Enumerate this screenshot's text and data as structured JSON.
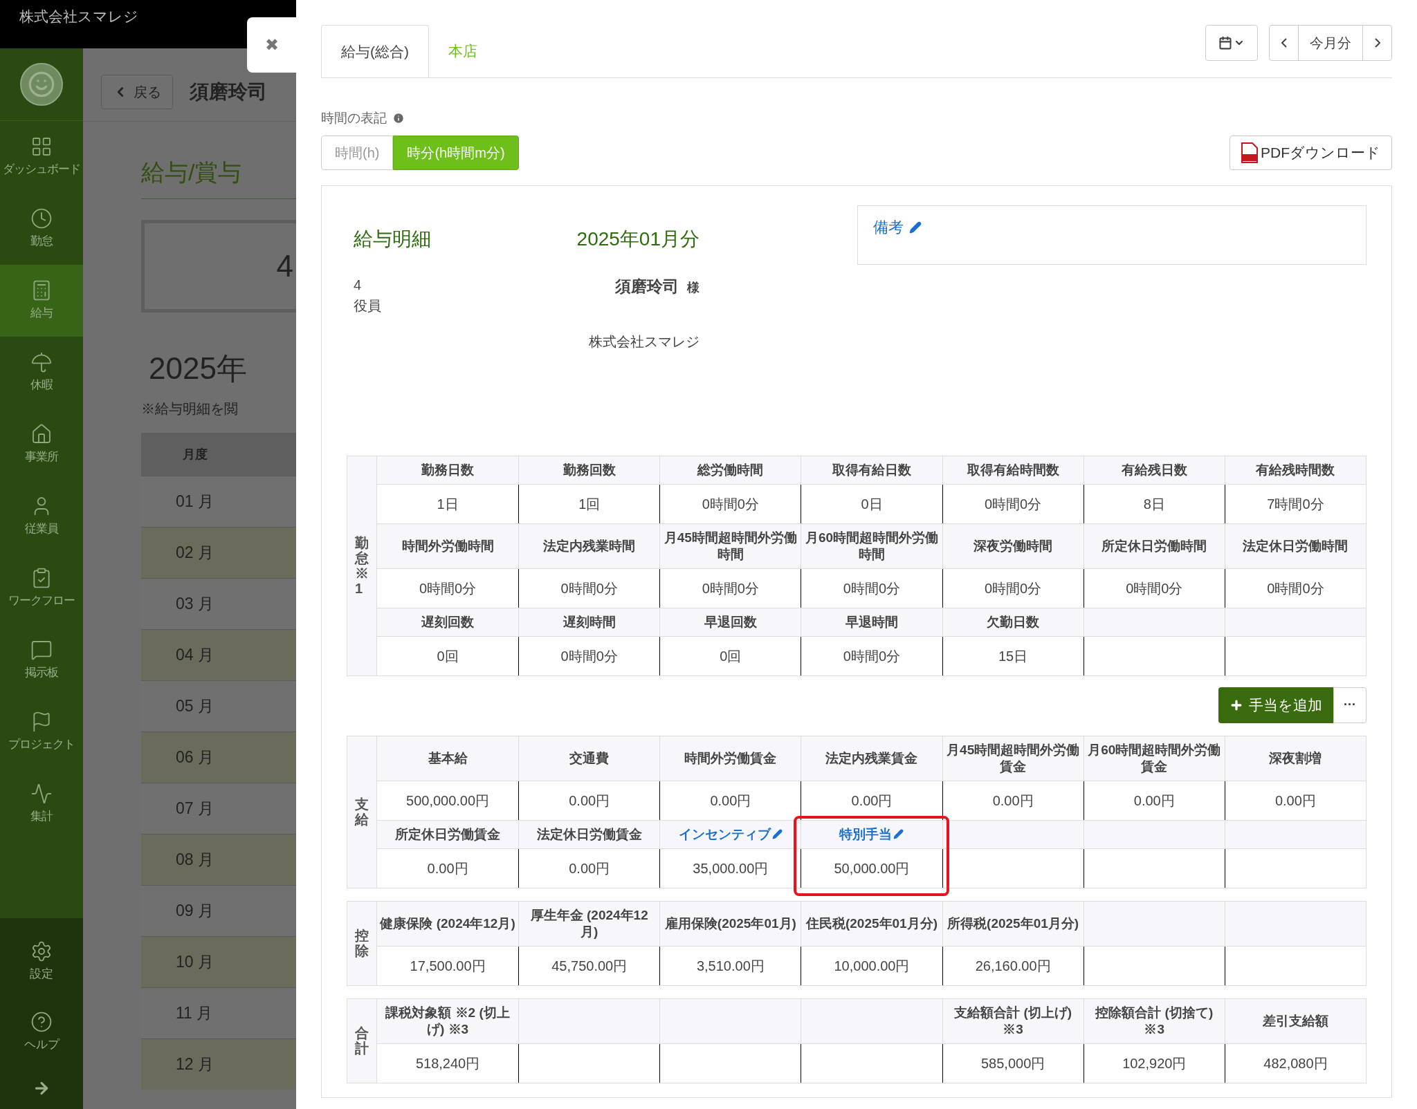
{
  "company": "株式会社スマレジ",
  "sidebar": {
    "items": [
      {
        "label": "ダッシュボード",
        "selected": false
      },
      {
        "label": "勤怠",
        "selected": false
      },
      {
        "label": "給与",
        "selected": true
      },
      {
        "label": "休暇",
        "selected": false
      },
      {
        "label": "事業所",
        "selected": false
      },
      {
        "label": "従業員",
        "selected": false
      },
      {
        "label": "ワークフロー",
        "selected": false
      },
      {
        "label": "掲示板",
        "selected": false
      },
      {
        "label": "プロジェクト",
        "selected": false
      },
      {
        "label": "集計",
        "selected": false
      }
    ],
    "bottom_items": [
      {
        "label": "設定"
      },
      {
        "label": "ヘルプ"
      }
    ]
  },
  "background": {
    "back_button": "戻る",
    "employee_name": "須磨玲司",
    "title": "給与/賞与",
    "card_text": "4",
    "year": "2025年",
    "note": "※給与明細を閲",
    "table_header": "月度",
    "months": [
      "01 月",
      "02 月",
      "03 月",
      "04 月",
      "05 月",
      "06 月",
      "07 月",
      "08 月",
      "09 月",
      "10 月",
      "11 月",
      "12 月"
    ]
  },
  "modal": {
    "close": "✖",
    "tabs": [
      {
        "label": "給与(総合)",
        "selected": true
      },
      {
        "label": "本店",
        "selected": false
      }
    ],
    "period": "今月分",
    "time_format": {
      "label": "時間の表記",
      "options": [
        {
          "label": "時間(h)",
          "selected": false
        },
        {
          "label": "時分(h時間m分)",
          "selected": true
        }
      ]
    },
    "pdf_button": "PDFダウンロード",
    "payslip": {
      "title": "給与明細",
      "month": "2025年01月分",
      "employee_number": "4",
      "position": "役員",
      "employee_name": "須磨玲司",
      "honorific": "様",
      "company": "株式会社スマレジ",
      "remarks": "備考"
    },
    "add_allowance_button": "手当を追加",
    "more_button": "···",
    "sections": [
      {
        "label": "勤怠※1",
        "rows": [
          {
            "cells": [
              {
                "header": "勤務日数",
                "value": "1日"
              },
              {
                "header": "勤務回数",
                "value": "1回"
              },
              {
                "header": "総労働時間",
                "value": "0時間0分"
              },
              {
                "header": "取得有給日数",
                "value": "0日"
              },
              {
                "header": "取得有給時間数",
                "value": "0時間0分"
              },
              {
                "header": "有給残日数",
                "value": "8日"
              },
              {
                "header": "有給残時間数",
                "value": "7時間0分"
              }
            ]
          },
          {
            "cells": [
              {
                "header": "時間外労働時間",
                "value": "0時間0分"
              },
              {
                "header": "法定内残業時間",
                "value": "0時間0分"
              },
              {
                "header": "月45時間超時間外労働時間",
                "value": "0時間0分"
              },
              {
                "header": "月60時間超時間外労働時間",
                "value": "0時間0分"
              },
              {
                "header": "深夜労働時間",
                "value": "0時間0分"
              },
              {
                "header": "所定休日労働時間",
                "value": "0時間0分"
              },
              {
                "header": "法定休日労働時間",
                "value": "0時間0分"
              }
            ]
          },
          {
            "cells": [
              {
                "header": "遅刻回数",
                "value": "0回"
              },
              {
                "header": "遅刻時間",
                "value": "0時間0分"
              },
              {
                "header": "早退回数",
                "value": "0回"
              },
              {
                "header": "早退時間",
                "value": "0時間0分"
              },
              {
                "header": "欠勤日数",
                "value": "15日"
              },
              {},
              {}
            ]
          }
        ]
      },
      {
        "label": "支給",
        "rows": [
          {
            "cells": [
              {
                "header": "基本給",
                "value": "500,000.00円"
              },
              {
                "header": "交通費",
                "value": "0.00円"
              },
              {
                "header": "時間外労働賃金",
                "value": "0.00円"
              },
              {
                "header": "法定内残業賃金",
                "value": "0.00円"
              },
              {
                "header": "月45時間超時間外労働賃金",
                "value": "0.00円"
              },
              {
                "header": "月60時間超時間外労働賃金",
                "value": "0.00円"
              },
              {
                "header": "深夜割増",
                "value": "0.00円"
              }
            ]
          },
          {
            "cells": [
              {
                "header": "所定休日労働賃金",
                "value": "0.00円"
              },
              {
                "header": "法定休日労働賃金",
                "value": "0.00円"
              },
              {
                "header": "インセンティブ",
                "value": "35,000.00円",
                "kind": "editable"
              },
              {
                "header": "特別手当",
                "value": "50,000.00円",
                "kind": "editable",
                "highlighted": true
              },
              {},
              {},
              {}
            ]
          }
        ]
      },
      {
        "label": "控除",
        "rows": [
          {
            "cells": [
              {
                "header": "健康保険 (2024年12月)",
                "value": "17,500.00円"
              },
              {
                "header": "厚生年金 (2024年12月)",
                "value": "45,750.00円"
              },
              {
                "header": "雇用保険(2025年01月)",
                "value": "3,510.00円"
              },
              {
                "header": "住民税(2025年01月分)",
                "value": "10,000.00円"
              },
              {
                "header": "所得税(2025年01月分)",
                "value": "26,160.00円"
              },
              {},
              {}
            ]
          }
        ]
      },
      {
        "label": "合計",
        "rows": [
          {
            "cells": [
              {
                "header": "課税対象額 ※2 (切上げ) ※3",
                "value": "518,240円"
              },
              {},
              {},
              {},
              {
                "header": "支給額合計 (切上げ) ※3",
                "value": "585,000円"
              },
              {
                "header": "控除額合計 (切捨て) ※3",
                "value": "102,920円"
              },
              {
                "header": "差引支給額",
                "value": "482,080円"
              }
            ]
          }
        ]
      }
    ]
  }
}
